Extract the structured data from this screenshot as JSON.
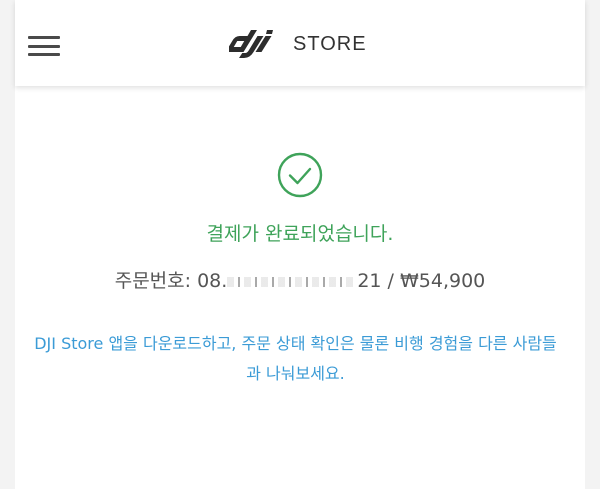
{
  "header": {
    "menu_icon": "hamburger-menu-icon",
    "logo_text": "STORE",
    "logo_mark": "dji"
  },
  "confirmation": {
    "check_icon": "check-circle-icon",
    "message": "결제가 완료되었습니다.",
    "order_label": "주문번호:",
    "order_prefix": "08.",
    "order_suffix": "21",
    "separator": "/",
    "amount": "₩54,900",
    "promo_line1": "DJI Store 앱을 다운로드하고, 주문 상태 확인은 물론 비행 경험을 다른 사람들",
    "promo_line2": "과 나눠보세요."
  },
  "colors": {
    "success": "#3fa35a",
    "link": "#3b9bd6",
    "text": "#555555"
  }
}
